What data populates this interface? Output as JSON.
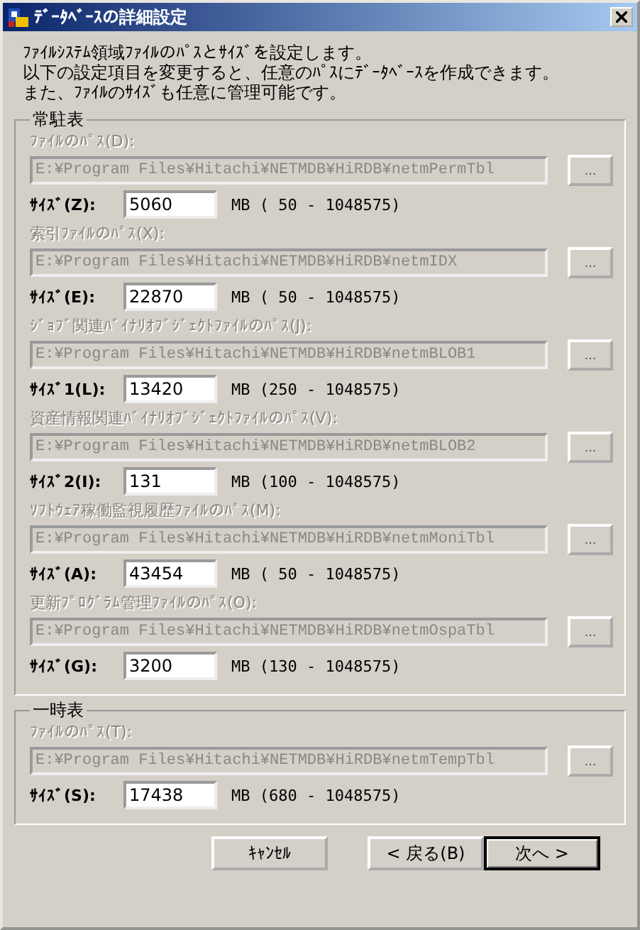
{
  "window": {
    "title": "ﾃﾞｰﾀﾍﾞｰｽの詳細設定"
  },
  "intro": [
    "ﾌｧｲﾙｼｽﾃﾑ領域ﾌｧｲﾙのﾊﾟｽとｻｲｽﾞを設定します。",
    "以下の設定項目を変更すると、任意のﾊﾟｽにﾃﾞｰﾀﾍﾞｰｽを作成できます。",
    "また、ﾌｧｲﾙのｻｲｽﾞも任意に管理可能です。"
  ],
  "groups": [
    {
      "title": "常駐表",
      "files": [
        {
          "path_label": "ﾌｧｲﾙのﾊﾟｽ(D):",
          "path": "E:¥Program Files¥Hitachi¥NETMDB¥HiRDB¥netmPermTbl",
          "disabled": true,
          "browse": "...",
          "size_label": "ｻｲｽﾞ(Z):",
          "size": "5060",
          "range": "MB ( 50 - 1048575)"
        },
        {
          "path_label": "索引ﾌｧｲﾙのﾊﾟｽ(X):",
          "path": "E:¥Program Files¥Hitachi¥NETMDB¥HiRDB¥netmIDX",
          "disabled": true,
          "browse": "...",
          "size_label": "ｻｲｽﾞ(E):",
          "size": "22870",
          "range": "MB ( 50 - 1048575)"
        },
        {
          "path_label": "ｼﾞｮﾌﾞ関連ﾊﾞｲﾅﾘｵﾌﾞｼﾞｪｸﾄﾌｧｲﾙのﾊﾟｽ(J):",
          "path": "E:¥Program Files¥Hitachi¥NETMDB¥HiRDB¥netmBLOB1",
          "disabled": true,
          "browse": "...",
          "size_label": "ｻｲｽﾞ1(L):",
          "size": "13420",
          "range": "MB (250 - 1048575)"
        },
        {
          "path_label": "資産情報関連ﾊﾞｲﾅﾘｵﾌﾞｼﾞｪｸﾄﾌｧｲﾙのﾊﾟｽ(V):",
          "path": "E:¥Program Files¥Hitachi¥NETMDB¥HiRDB¥netmBLOB2",
          "disabled": true,
          "browse": "...",
          "size_label": "ｻｲｽﾞ2(I):",
          "size": "131",
          "range": "MB (100 - 1048575)"
        },
        {
          "path_label": "ｿﾌﾄｳｪｱ稼働監視履歴ﾌｧｲﾙのﾊﾟｽ(M):",
          "path": "E:¥Program Files¥Hitachi¥NETMDB¥HiRDB¥netmMoniTbl",
          "disabled": true,
          "browse": "...",
          "size_label": "ｻｲｽﾞ(A):",
          "size": "43454",
          "range": "MB ( 50 - 1048575)"
        },
        {
          "path_label": "更新ﾌﾟﾛｸﾞﾗﾑ管理ﾌｧｲﾙのﾊﾟｽ(O):",
          "path": "E:¥Program Files¥Hitachi¥NETMDB¥HiRDB¥netmOspaTbl",
          "disabled": true,
          "browse": "...",
          "size_label": "ｻｲｽﾞ(G):",
          "size": "3200",
          "range": "MB (130 - 1048575)"
        }
      ]
    },
    {
      "title": "一時表",
      "files": [
        {
          "path_label": "ﾌｧｲﾙのﾊﾟｽ(T):",
          "path": "E:¥Program Files¥Hitachi¥NETMDB¥HiRDB¥netmTempTbl",
          "disabled": true,
          "browse": "...",
          "size_label": "ｻｲｽﾞ(S):",
          "size": "17438",
          "range": "MB (680 - 1048575)"
        }
      ]
    }
  ],
  "buttons": [
    {
      "label": "ｷｬﾝｾﾙ",
      "default": false
    },
    {
      "label": "< 戻る(B)",
      "default": false
    },
    {
      "label": "次へ >",
      "default": true
    }
  ]
}
